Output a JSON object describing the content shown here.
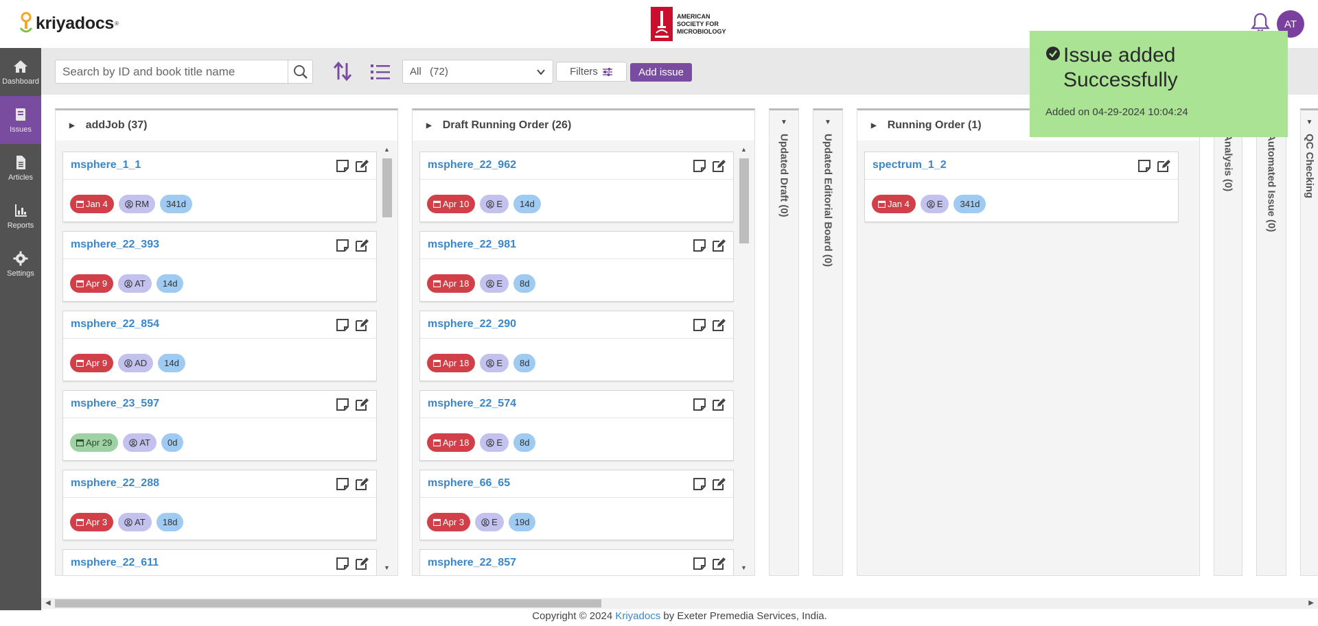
{
  "header": {
    "logo_text": "kriyadocs",
    "logo_reg": "®",
    "partner_text": "AMERICAN SOCIETY FOR MICROBIOLOGY",
    "avatar_initials": "AT"
  },
  "sidebar": {
    "items": [
      {
        "label": "Dashboard",
        "icon": "home-icon",
        "active": false
      },
      {
        "label": "Issues",
        "icon": "book-icon",
        "active": true
      },
      {
        "label": "Articles",
        "icon": "document-icon",
        "active": false
      },
      {
        "label": "Reports",
        "icon": "chart-icon",
        "active": false
      },
      {
        "label": "Settings",
        "icon": "gear-icon",
        "active": false
      }
    ]
  },
  "toolbar": {
    "search_placeholder": "Search by ID and book title name",
    "select_value": "All   (72)",
    "filters_label": "Filters",
    "add_issue_label": "Add issue"
  },
  "columns": [
    {
      "title": "addJob (37)",
      "cards": [
        {
          "title": "msphere_1_1",
          "date": "Jan 4",
          "date_status": "overdue",
          "user": "RM",
          "days": "341d"
        },
        {
          "title": "msphere_22_393",
          "date": "Apr 9",
          "date_status": "overdue",
          "user": "AT",
          "days": "14d"
        },
        {
          "title": "msphere_22_854",
          "date": "Apr 9",
          "date_status": "overdue",
          "user": "AD",
          "days": "14d"
        },
        {
          "title": "msphere_23_597",
          "date": "Apr 29",
          "date_status": "ontime",
          "user": "AT",
          "days": "0d"
        },
        {
          "title": "msphere_22_288",
          "date": "Apr 3",
          "date_status": "overdue",
          "user": "AT",
          "days": "18d"
        },
        {
          "title": "msphere_22_611",
          "date": "",
          "date_status": "",
          "user": "",
          "days": ""
        }
      ]
    },
    {
      "title": "Draft Running Order (26)",
      "cards": [
        {
          "title": "msphere_22_962",
          "date": "Apr 10",
          "date_status": "overdue",
          "user": "E",
          "days": "14d"
        },
        {
          "title": "msphere_22_981",
          "date": "Apr 18",
          "date_status": "overdue",
          "user": "E",
          "days": "8d"
        },
        {
          "title": "msphere_22_290",
          "date": "Apr 18",
          "date_status": "overdue",
          "user": "E",
          "days": "8d"
        },
        {
          "title": "msphere_22_574",
          "date": "Apr 18",
          "date_status": "overdue",
          "user": "E",
          "days": "8d"
        },
        {
          "title": "msphere_66_65",
          "date": "Apr 3",
          "date_status": "overdue",
          "user": "E",
          "days": "19d"
        },
        {
          "title": "msphere_22_857",
          "date": "",
          "date_status": "",
          "user": "",
          "days": ""
        }
      ]
    },
    {
      "title": "Running Order (1)",
      "cards": [
        {
          "title": "spectrum_1_2",
          "date": "Jan 4",
          "date_status": "overdue",
          "user": "E",
          "days": "341d"
        }
      ]
    }
  ],
  "collapsed_columns": [
    "Updated Draft (0)",
    "Updated Editorial Board (0)",
    "Analysis (0)",
    "Automated Issue (0)",
    "QC Checking"
  ],
  "toast": {
    "title": "Issue added Successfully",
    "subtitle": "Added on 04-29-2024 10:04:24"
  },
  "footer": {
    "prefix": "Copyright © 2024 ",
    "link": "Kriyadocs",
    "suffix": " by Exeter Premedia Services, India."
  },
  "colors": {
    "brand_purple": "#7a4c9f",
    "sidebar_bg": "#525252",
    "date_overdue": "#d14048",
    "date_ontime": "#9ed2a4",
    "user_badge": "#c3c1ee",
    "days_badge": "#9fcbf2",
    "link_blue": "#3a86c8",
    "toast_green": "#a9e393"
  }
}
